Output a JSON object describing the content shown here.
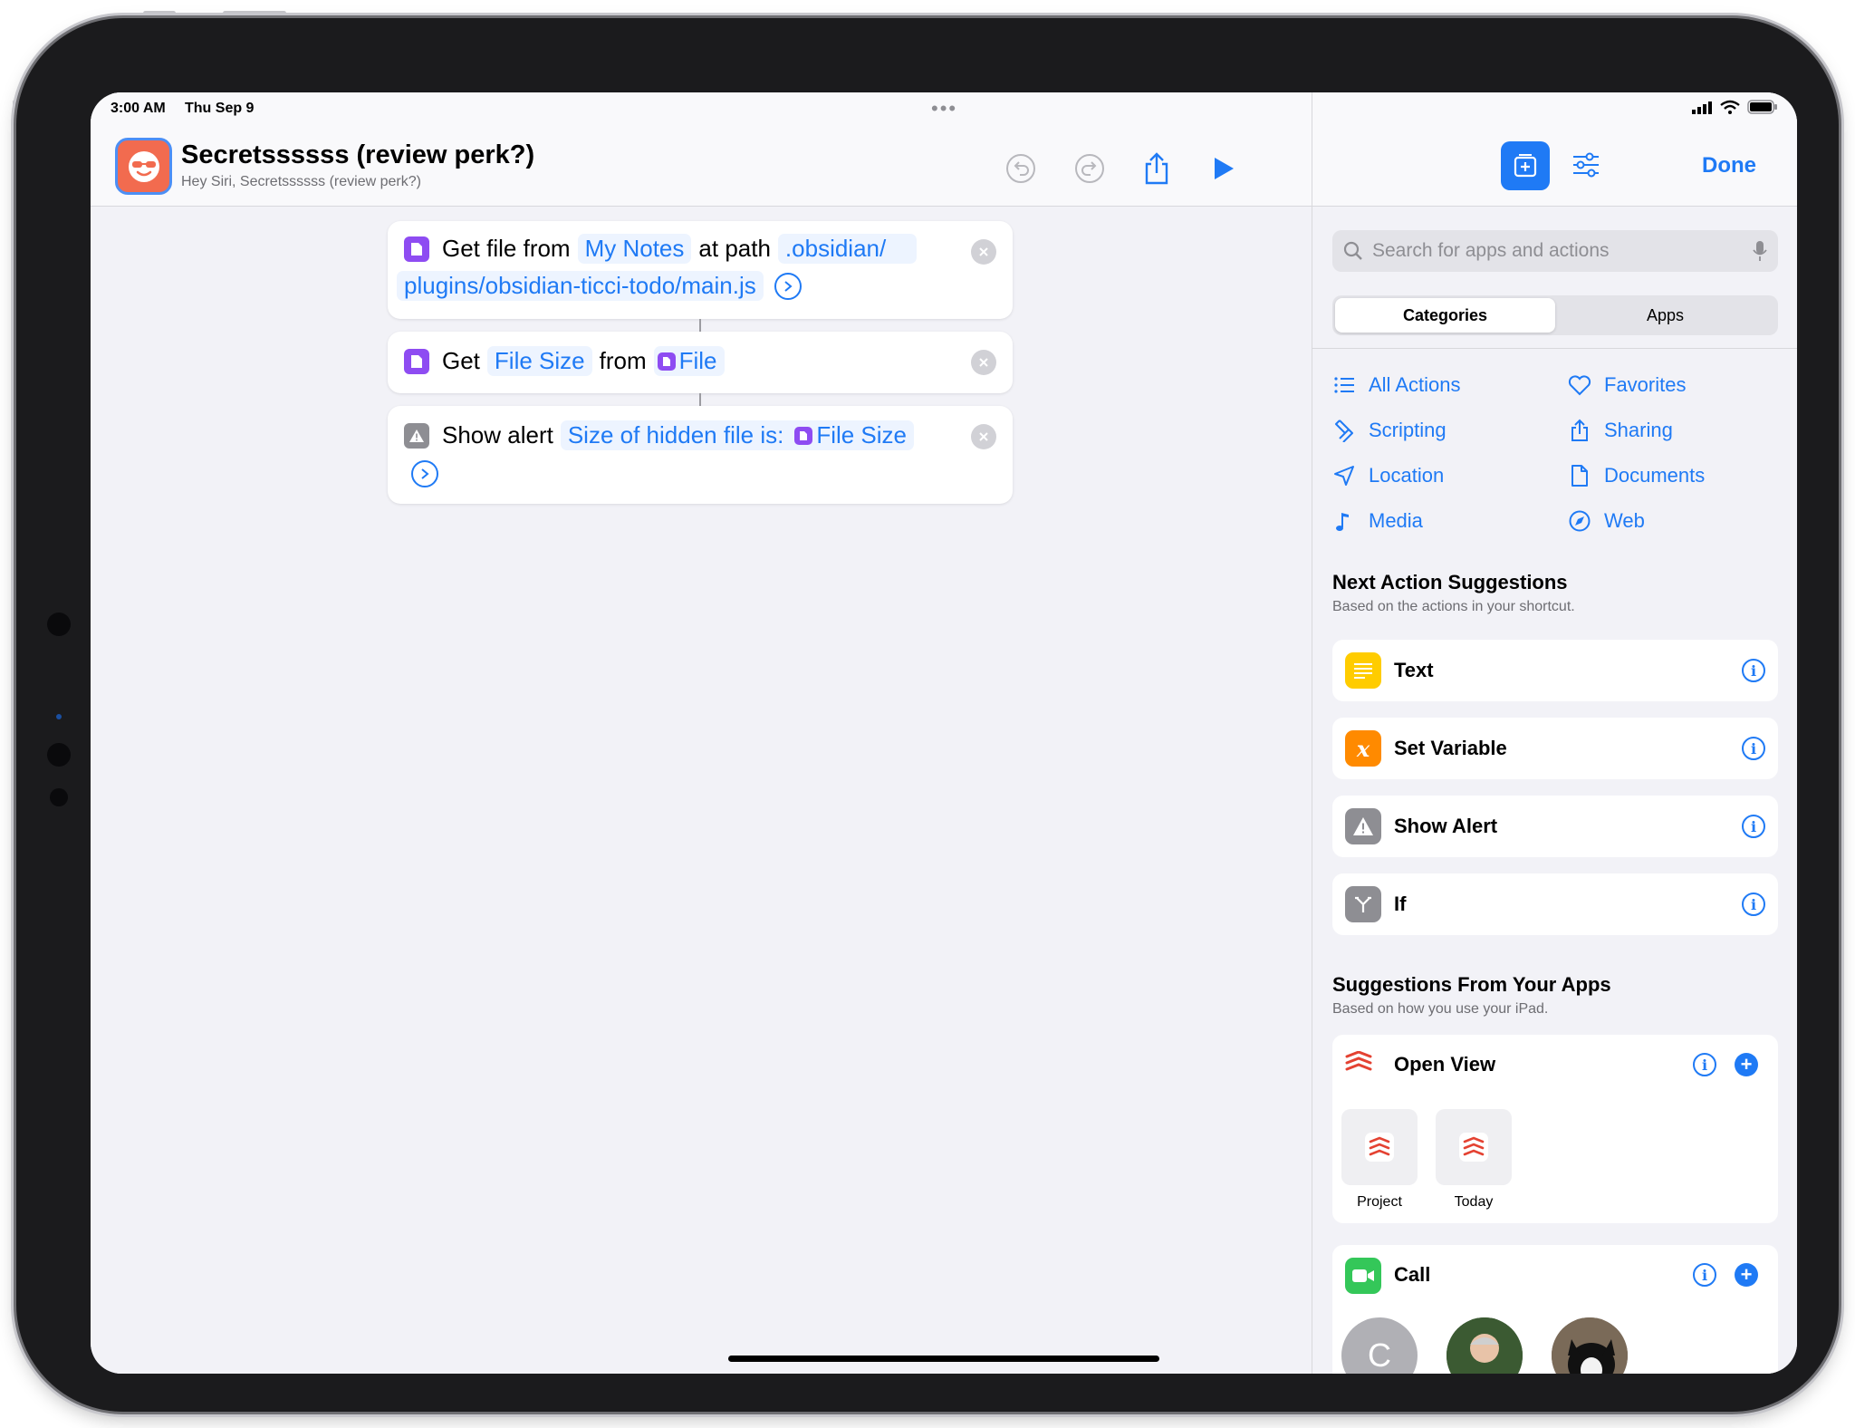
{
  "status": {
    "time": "3:00 AM",
    "date": "Thu Sep 9"
  },
  "shortcut": {
    "title": "Secretssssss (review perk?)",
    "subtitle": "Hey Siri, Secretssssss (review perk?)"
  },
  "actions": [
    {
      "verb": "Get file from",
      "source": "My Notes",
      "mid": "at path",
      "path1": ".obsidian/",
      "path2": "plugins/obsidian-ticci-todo/main.js"
    },
    {
      "verb": "Get",
      "property": "File Size",
      "mid": "from",
      "variable": "File"
    },
    {
      "verb": "Show alert",
      "message": "Size of hidden file is:",
      "variable": "File Size"
    }
  ],
  "panel": {
    "done_label": "Done",
    "search_placeholder": "Search for apps and actions",
    "segments": [
      "Categories",
      "Apps"
    ],
    "categories": [
      {
        "label": "All Actions",
        "icon": "list-icon"
      },
      {
        "label": "Favorites",
        "icon": "heart-icon"
      },
      {
        "label": "Scripting",
        "icon": "scripting-icon"
      },
      {
        "label": "Sharing",
        "icon": "share-icon"
      },
      {
        "label": "Location",
        "icon": "location-arrow-icon"
      },
      {
        "label": "Documents",
        "icon": "document-icon"
      },
      {
        "label": "Media",
        "icon": "music-note-icon"
      },
      {
        "label": "Web",
        "icon": "compass-icon"
      }
    ],
    "next_title": "Next Action Suggestions",
    "next_subtitle": "Based on the actions in your shortcut.",
    "next_suggestions": [
      {
        "label": "Text",
        "icon": "text-icon",
        "color": "#ffcc00"
      },
      {
        "label": "Set Variable",
        "icon": "variable-icon",
        "color": "#ff8a00"
      },
      {
        "label": "Show Alert",
        "icon": "alert-icon",
        "color": "#8e8e93"
      },
      {
        "label": "If",
        "icon": "branch-icon",
        "color": "#8e8e93"
      }
    ],
    "apps_title": "Suggestions From Your Apps",
    "apps_subtitle": "Based on how you use your iPad.",
    "open_view": {
      "label": "Open View",
      "tiles": [
        "Project",
        "Today"
      ]
    },
    "call": {
      "label": "Call",
      "contact_initial": "C"
    }
  },
  "colors": {
    "accent": "#1f7af5",
    "file_purple": "#8e4cf2",
    "app_icon": "#f26b4f",
    "todoist_red": "#e44232",
    "facetime_green": "#34c759"
  }
}
